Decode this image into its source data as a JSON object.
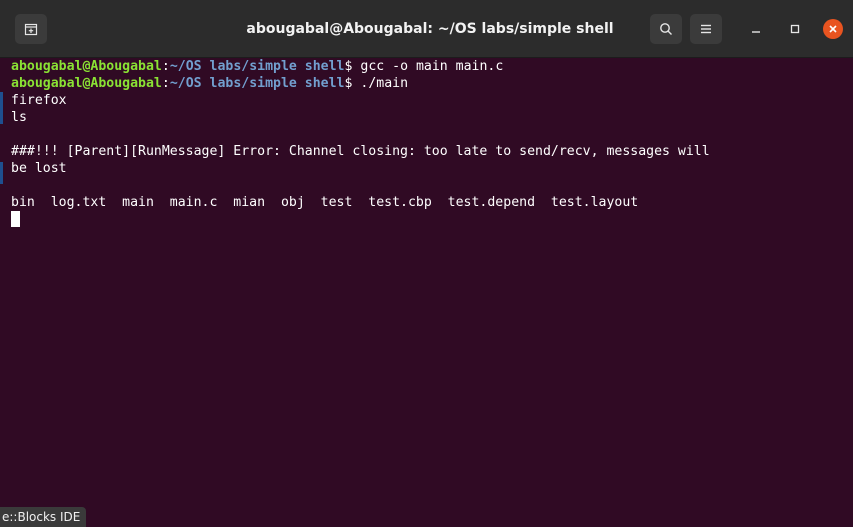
{
  "window": {
    "title": "abougabal@Abougabal: ~/OS labs/simple shell"
  },
  "titlebar": {
    "new_tab_icon": "new-tab-icon",
    "search_icon": "search-icon",
    "menu_icon": "hamburger-menu-icon",
    "minimize_icon": "minimize-icon",
    "maximize_icon": "maximize-icon",
    "close_icon": "close-icon",
    "close_color": "#e95420"
  },
  "terminal": {
    "colors": {
      "background": "#300a24",
      "user_host": "#8ae234",
      "path": "#729fcf",
      "text": "#ffffff"
    },
    "prompt_user": "abougabal@Abougabal",
    "prompt_sep": ":",
    "prompt_path": "~/OS labs/simple shell",
    "prompt_suffix": "$ ",
    "command1": "gcc -o main main.c",
    "command2": "./main",
    "input1": "firefox",
    "input2": "ls",
    "error_line1": "###!!! [Parent][RunMessage] Error: Channel closing: too late to send/recv, messages will",
    "error_line2": "be lost",
    "ls_output": "bin  log.txt  main  main.c  mian  obj  test  test.cbp  test.depend  test.layout"
  },
  "taskbar": {
    "label": "e::Blocks IDE"
  }
}
